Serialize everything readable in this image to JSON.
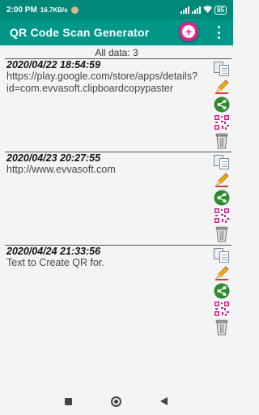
{
  "status_bar": {
    "time": "2:00 PM",
    "speed": "16.7KB/s",
    "battery": "85"
  },
  "app_bar": {
    "title": "QR Code Scan Generator"
  },
  "summary": {
    "all_data_label": "All data: 3"
  },
  "records": [
    {
      "date": "2020/04/22 18:54:59",
      "text": "https://play.google.com/store/apps/details?id=com.evvasoft.clipboardcopypaster"
    },
    {
      "date": "2020/04/23 20:27:55",
      "text": "http://www.evvasoft.com"
    },
    {
      "date": "2020/04/24 21:33:56",
      "text": "Text to Create QR for."
    }
  ],
  "record_actions": [
    "copy-icon",
    "edit-icon",
    "share-icon",
    "qr-code-icon",
    "trash-icon"
  ],
  "colors": {
    "status_bar": "#00897b",
    "app_bar": "#009688",
    "fab": "#e91e8c",
    "share": "#2e8b2e",
    "qr": "#d81b8a"
  }
}
